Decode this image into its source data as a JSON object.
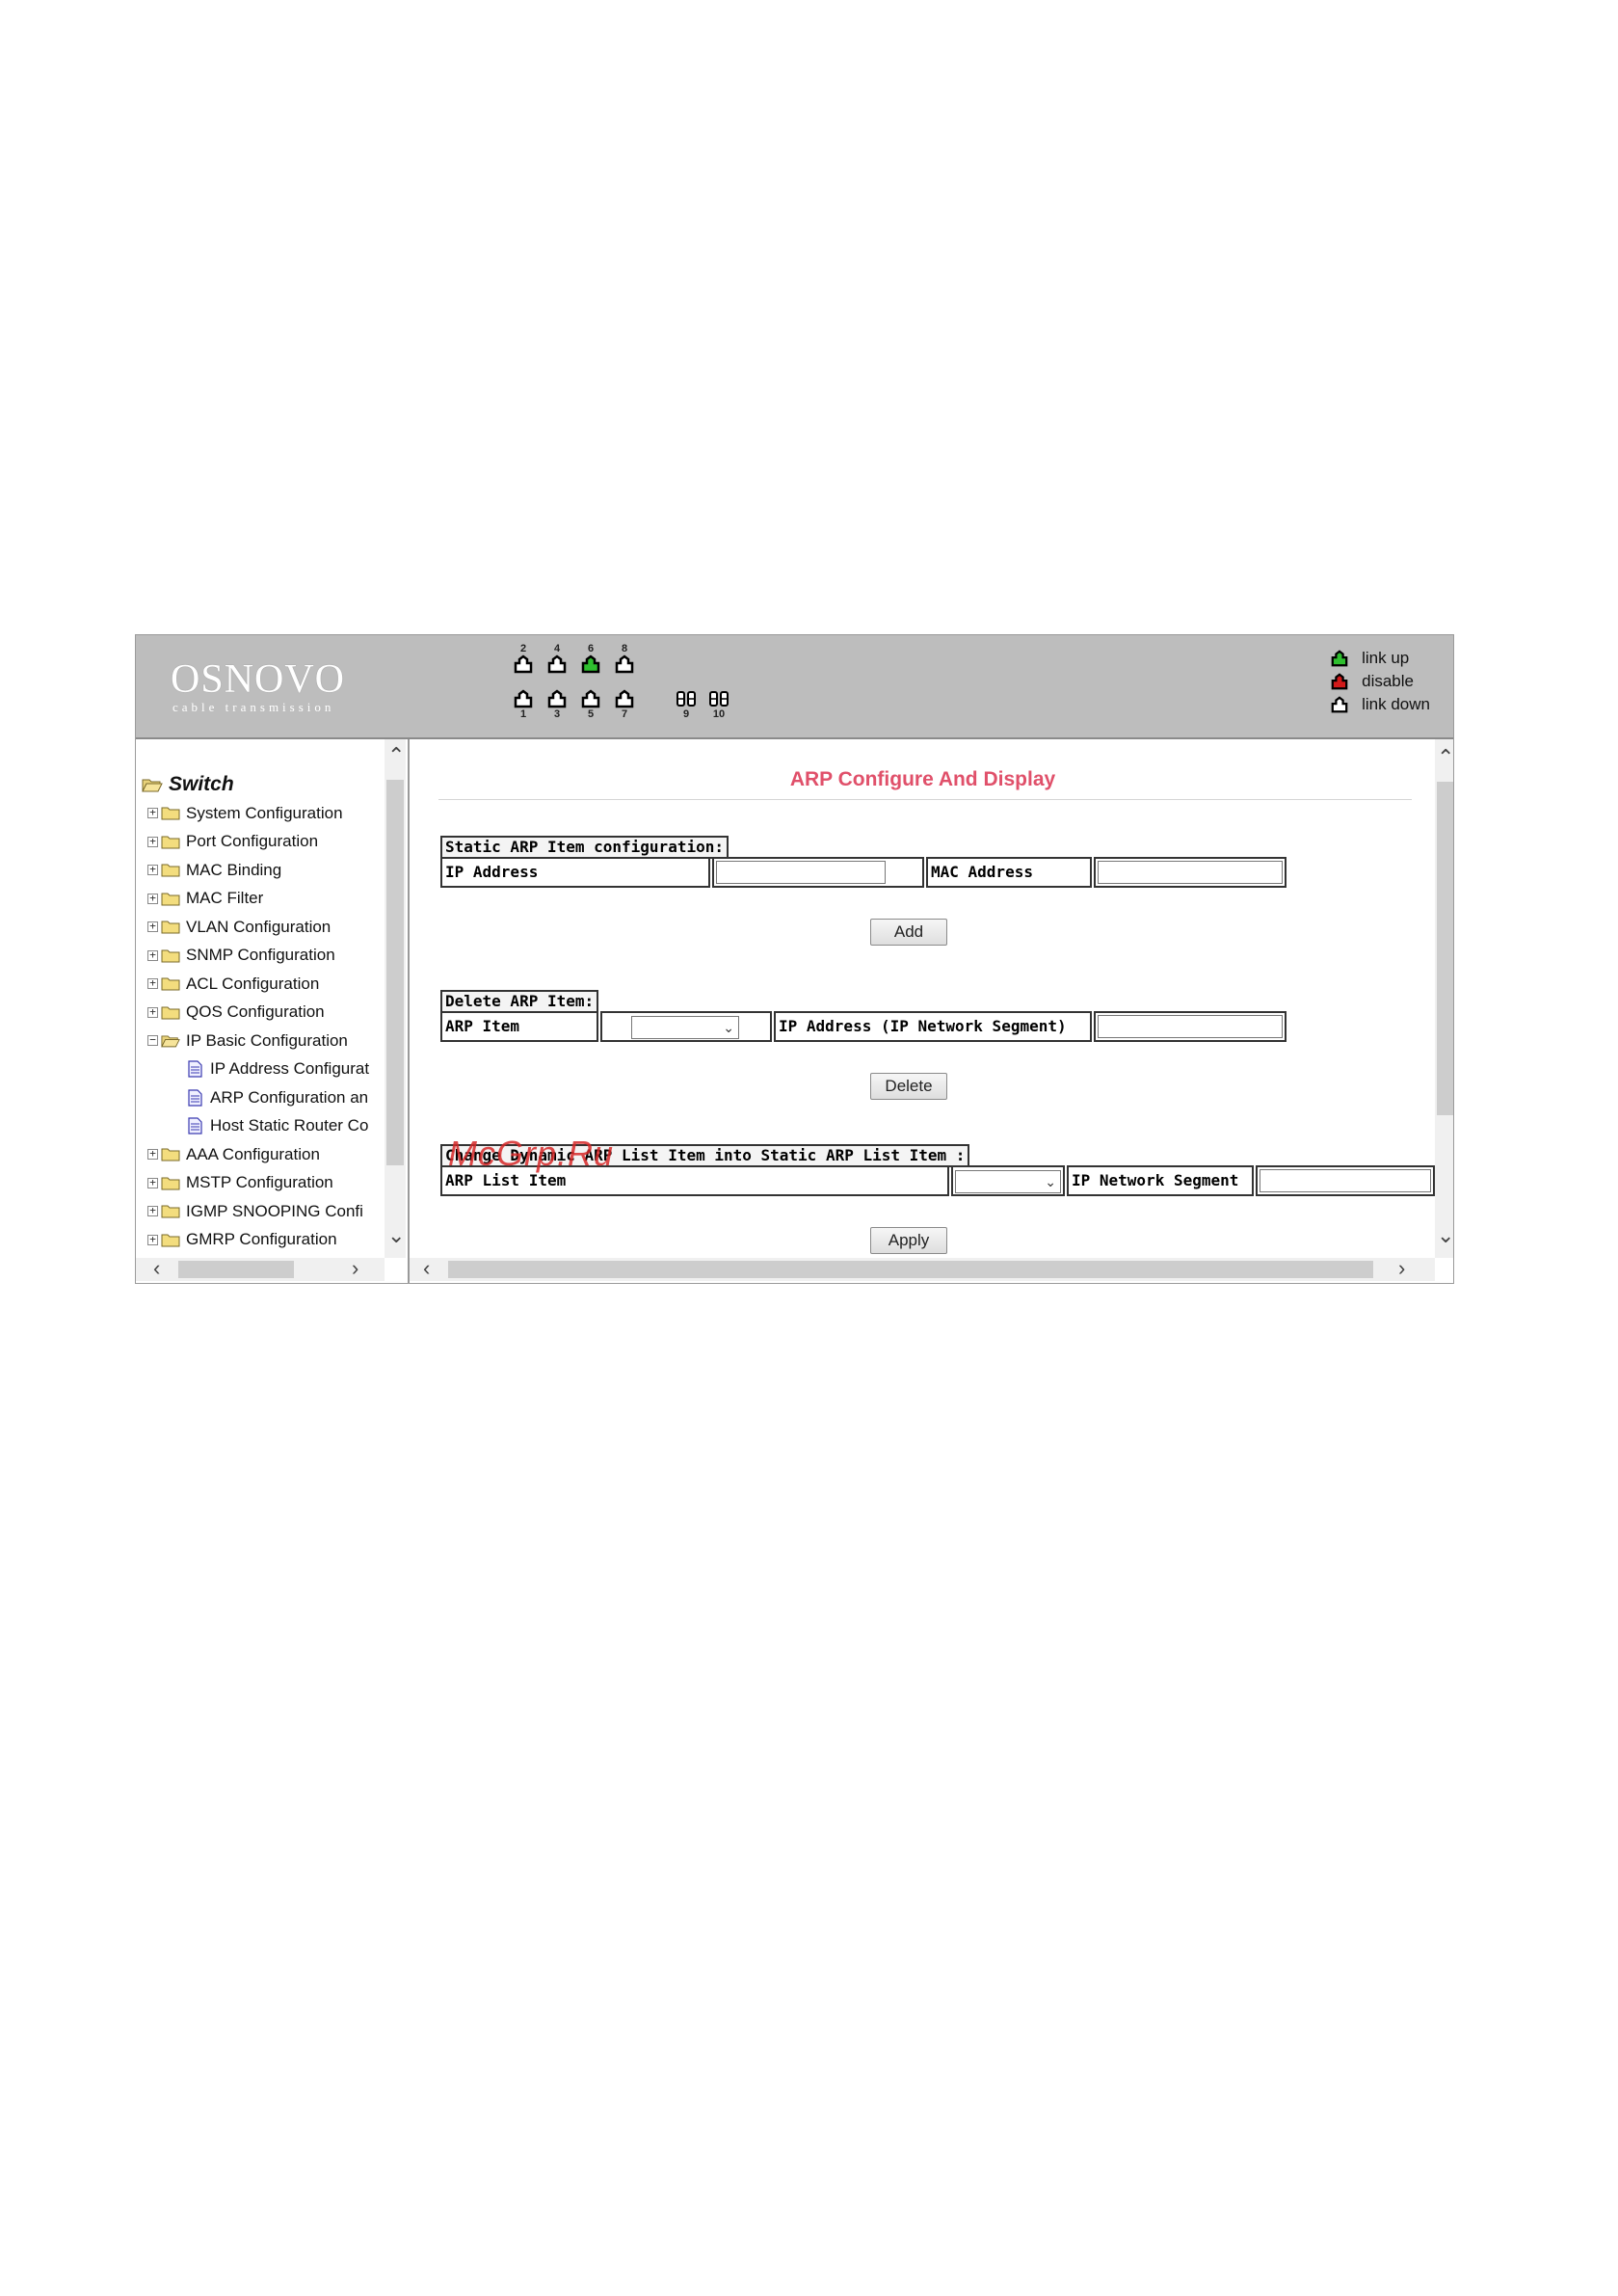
{
  "header": {
    "brand": "OSNOVO",
    "tagline": "cable transmission",
    "ports_top": [
      {
        "num": "2",
        "status": "link-down"
      },
      {
        "num": "4",
        "status": "link-down"
      },
      {
        "num": "6",
        "status": "link-up"
      },
      {
        "num": "8",
        "status": "link-down"
      }
    ],
    "ports_bottom": [
      {
        "num": "1",
        "status": "link-down"
      },
      {
        "num": "3",
        "status": "link-down"
      },
      {
        "num": "5",
        "status": "link-down"
      },
      {
        "num": "7",
        "status": "link-down"
      }
    ],
    "ports_fiber": [
      {
        "num": "9",
        "status": "link-down"
      },
      {
        "num": "10",
        "status": "link-down"
      }
    ],
    "legend": [
      {
        "label": "link up",
        "color": "#2fbf2f"
      },
      {
        "label": "disable",
        "color": "#d11a1a"
      },
      {
        "label": "link down",
        "color": "#ffffff"
      }
    ]
  },
  "sidebar": {
    "root": "Switch",
    "items": [
      {
        "label": "System Configuration",
        "type": "folder"
      },
      {
        "label": "Port Configuration",
        "type": "folder"
      },
      {
        "label": "MAC Binding",
        "type": "folder"
      },
      {
        "label": "MAC Filter",
        "type": "folder"
      },
      {
        "label": "VLAN Configuration",
        "type": "folder"
      },
      {
        "label": "SNMP Configuration",
        "type": "folder"
      },
      {
        "label": "ACL Configuration",
        "type": "folder"
      },
      {
        "label": "QOS Configuration",
        "type": "folder"
      },
      {
        "label": "IP Basic Configuration",
        "type": "folder-open"
      },
      {
        "label": "IP Address Configurat",
        "type": "page"
      },
      {
        "label": "ARP Configuration an",
        "type": "page"
      },
      {
        "label": "Host Static Router Co",
        "type": "page"
      },
      {
        "label": "AAA Configuration",
        "type": "folder"
      },
      {
        "label": "MSTP Configuration",
        "type": "folder"
      },
      {
        "label": "IGMP SNOOPING Confi",
        "type": "folder"
      },
      {
        "label": "GMRP Configuration",
        "type": "folder"
      }
    ]
  },
  "main": {
    "title": "ARP Configure And Display",
    "static": {
      "header": "Static ARP Item configuration:",
      "ip_label": "IP Address",
      "ip_value": "",
      "mac_label": "MAC Address",
      "mac_value": "",
      "button": "Add"
    },
    "delete": {
      "header": "Delete ARP Item:",
      "item_label": "ARP Item",
      "item_selected": "",
      "ip_label": "IP Address  (IP Network Segment)",
      "ip_value": "",
      "button": "Delete"
    },
    "change": {
      "header": "Change Dynamic ARP List Item into Static ARP List Item :",
      "item_label": "ARP List Item",
      "item_selected": "",
      "segment_label": "IP Network Segment",
      "segment_value": "",
      "button": "Apply"
    }
  },
  "watermark": "McGrp.Ru"
}
